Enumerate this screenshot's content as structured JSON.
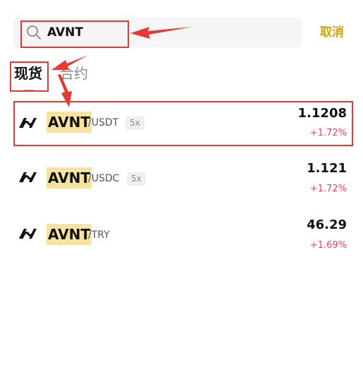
{
  "search": {
    "value": "AVNT",
    "cancel_label": "取消"
  },
  "tabs": [
    {
      "label": "现货",
      "active": true
    },
    {
      "label": "合约",
      "active": false
    }
  ],
  "rows": [
    {
      "base": "AVNT",
      "quote": "/USDT",
      "leverage": "5x",
      "price": "1.1208",
      "change": "+1.72%"
    },
    {
      "base": "AVNT",
      "quote": "/USDC",
      "leverage": "5x",
      "price": "1.121",
      "change": "+1.72%"
    },
    {
      "base": "AVNT",
      "quote": "/TRY",
      "leverage": "",
      "price": "46.29",
      "change": "+1.69%"
    }
  ],
  "colors": {
    "accent": "#d4a106",
    "tab_underline": "#f0a12a",
    "positive_change": "#ee3d5a",
    "highlight": "#f7e3a0",
    "annotation": "#e53935"
  },
  "icons": [
    "search-icon",
    "avantis-logo-icon"
  ]
}
